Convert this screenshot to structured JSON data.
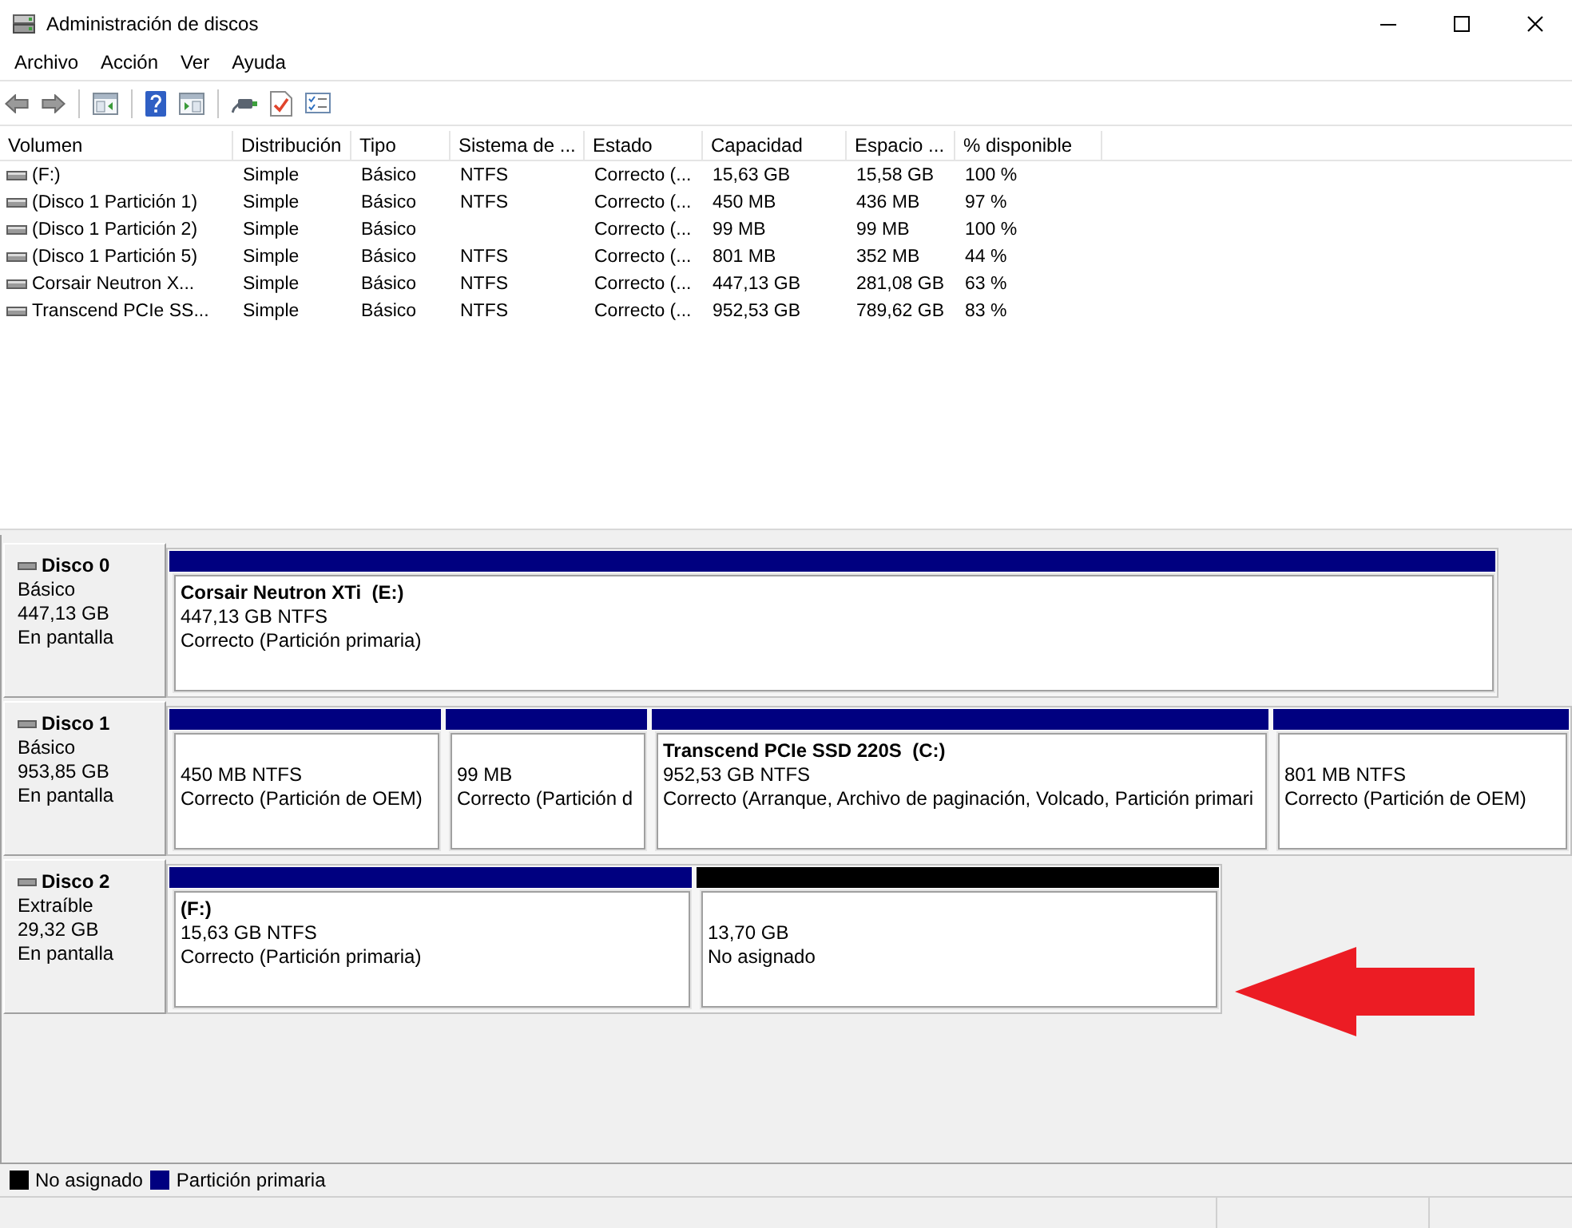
{
  "window": {
    "title": "Administración de discos",
    "controls": [
      {
        "kind": "minimize"
      },
      {
        "kind": "maximize"
      },
      {
        "kind": "close"
      }
    ]
  },
  "menu": [
    "Archivo",
    "Acción",
    "Ver",
    "Ayuda"
  ],
  "toolbar": [
    {
      "kind": "back"
    },
    {
      "kind": "forward"
    },
    {
      "kind": "separator"
    },
    {
      "kind": "console_tree"
    },
    {
      "kind": "separator"
    },
    {
      "kind": "help"
    },
    {
      "kind": "action_pane"
    },
    {
      "kind": "separator"
    },
    {
      "kind": "connect"
    },
    {
      "kind": "check"
    },
    {
      "kind": "checklist"
    }
  ],
  "volume_list": {
    "columns": [
      "Volumen",
      "Distribución",
      "Tipo",
      "Sistema de ...",
      "Estado",
      "Capacidad",
      "Espacio ...",
      "% disponible"
    ],
    "rows": [
      {
        "volume": "(F:)",
        "layout": "Simple",
        "type": "Básico",
        "file_system": "NTFS",
        "status": "Correcto (...",
        "capacity": "15,63 GB",
        "free_space": "15,58 GB",
        "percent_free": "100 %"
      },
      {
        "volume": "(Disco 1 Partición 1)",
        "layout": "Simple",
        "type": "Básico",
        "file_system": "NTFS",
        "status": "Correcto (...",
        "capacity": "450 MB",
        "free_space": "436 MB",
        "percent_free": "97 %"
      },
      {
        "volume": "(Disco 1 Partición 2)",
        "layout": "Simple",
        "type": "Básico",
        "status": "Correcto (...",
        "capacity": "99 MB",
        "free_space": "99 MB",
        "percent_free": "100 %"
      },
      {
        "volume": "(Disco 1 Partición 5)",
        "layout": "Simple",
        "type": "Básico",
        "file_system": "NTFS",
        "status": "Correcto (...",
        "capacity": "801 MB",
        "free_space": "352 MB",
        "percent_free": "44 %"
      },
      {
        "volume": "Corsair Neutron X...",
        "layout": "Simple",
        "type": "Básico",
        "file_system": "NTFS",
        "status": "Correcto (...",
        "capacity": "447,13 GB",
        "free_space": "281,08 GB",
        "percent_free": "63 %"
      },
      {
        "volume": "Transcend PCIe SS...",
        "layout": "Simple",
        "type": "Básico",
        "file_system": "NTFS",
        "status": "Correcto (...",
        "capacity": "952,53 GB",
        "free_space": "789,62 GB",
        "percent_free": "83 %"
      }
    ]
  },
  "disks": [
    {
      "name": "Disco 0",
      "type": "Básico",
      "size": "447,13 GB",
      "status": "En pantalla",
      "partitions": [
        {
          "color": "#000080",
          "title": "Corsair Neutron XTi  (E:)",
          "size": "447,13 GB NTFS",
          "status": "Correcto (Partición primaria)"
        }
      ]
    },
    {
      "name": "Disco 1",
      "type": "Básico",
      "size": "953,85 GB",
      "status": "En pantalla",
      "partitions": [
        {
          "color": "#000080",
          "size": "450 MB NTFS",
          "status": "Correcto (Partición de OEM)"
        },
        {
          "color": "#000080",
          "size": "99 MB",
          "status": "Correcto (Partición d"
        },
        {
          "color": "#000080",
          "title": "Transcend PCIe SSD 220S  (C:)",
          "size": "952,53 GB NTFS",
          "status": "Correcto (Arranque, Archivo de paginación, Volcado, Partición primari"
        },
        {
          "color": "#000080",
          "size": "801 MB NTFS",
          "status": "Correcto (Partición de OEM)"
        }
      ]
    },
    {
      "name": "Disco 2",
      "type": "Extraíble",
      "size": "29,32 GB",
      "status": "En pantalla",
      "partitions": [
        {
          "color": "#000080",
          "title": "(F:)",
          "size": "15,63 GB NTFS",
          "status": "Correcto (Partición primaria)"
        },
        {
          "color": "#000000",
          "size": "13,70 GB",
          "status": "No asignado"
        }
      ]
    }
  ],
  "callout": {
    "kind": "arrow"
  },
  "legend": [
    {
      "label": "No asignado",
      "color": "#000000"
    },
    {
      "label": "Partición primaria",
      "color": "#000080"
    }
  ]
}
